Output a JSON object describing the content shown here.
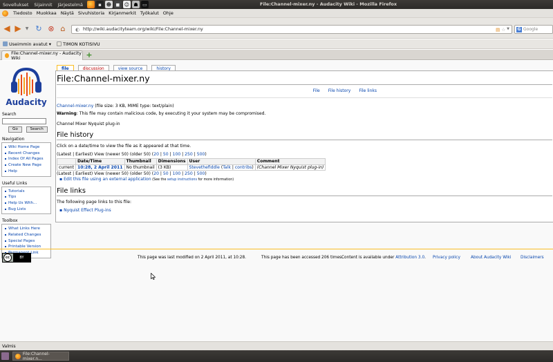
{
  "top_panel": {
    "menus": [
      "Sovellukset",
      "Sijainnit",
      "Järjestelmä"
    ],
    "window_title": "File:Channel-mixer.ny - Audacity Wiki - Mozilla Firefox"
  },
  "menubar": [
    "Tiedosto",
    "Muokkaa",
    "Näytä",
    "Sivuhistoria",
    "Kirjanmerkit",
    "Työkalut",
    "Ohje"
  ],
  "url": "http://wiki.audacityteam.org/wiki/File:Channel-mixer.ny",
  "search_engine": "Google",
  "bookmarks": [
    "Useimmin avatut ▾",
    "TIMON KOTISIVU"
  ],
  "tab_title": "File:Channel-mixer.ny - Audacity Wiki",
  "logo_text": "Audacity",
  "sidebar": {
    "search_label": "Search",
    "go_label": "Go",
    "search_button": "Search",
    "navigation_title": "Navigation",
    "navigation": [
      "Wiki Home Page",
      "Recent Changes",
      "Index Of All Pages",
      "Create New Page",
      "Help"
    ],
    "useful_links_title": "Useful Links",
    "useful_links": [
      "Tutorials",
      "Tips",
      "Help Us With...",
      "Bug Lists"
    ],
    "toolbox_title": "Toolbox",
    "toolbox": [
      "What Links Here",
      "Related Changes",
      "Special Pages",
      "Printable Version",
      "Permanent Link"
    ]
  },
  "content_tabs": [
    "file",
    "discussion",
    "view source",
    "history"
  ],
  "page": {
    "title": "File:Channel-mixer.ny",
    "toc": [
      "File",
      "File history",
      "File links"
    ],
    "file_link": "Channel-mixer.ny",
    "file_info": " (file size: 3 KB, MIME type: text/plain)",
    "warning_label": "Warning",
    "warning_text": ": This file may contain malicious code, by executing it your system may be compromised.",
    "description": "Channel Mixer Nyquist plug-in",
    "history_heading": "File history",
    "history_intro": "Click on a date/time to view the file as it appeared at that time.",
    "paging_prefix": "(Latest | Earliest) View (newer 50) (older 50) (",
    "paging_options": [
      "20",
      "50",
      "100",
      "250",
      "500"
    ],
    "paging_suffix": ")",
    "table_headers": [
      "",
      "Date/Time",
      "Thumbnail",
      "Dimensions",
      "User",
      "Comment"
    ],
    "row": {
      "status": "current",
      "datetime": "10:28, 2 April 2011",
      "thumbnail": "No thumbnail",
      "dimensions": "(3 KB)",
      "user": "Stevethefiddle",
      "user_talk": "Talk",
      "user_contribs": "contribs",
      "comment": "(Channel Mixer Nyquist plug-in)"
    },
    "edit_external": "Edit this file using an external application",
    "edit_external_note_prefix": " (See the ",
    "edit_external_note_link": "setup instructions",
    "edit_external_note_suffix": " for more information)",
    "links_heading": "File links",
    "links_intro": "The following page links to this file:",
    "links": [
      "Nyquist Effect Plug-ins"
    ]
  },
  "footer": {
    "lastmod": "This page was last modified on 2 April 2011, at 10:28.",
    "viewcount": "This page has been accessed 206 times.",
    "copyright_prefix": "Content is available under ",
    "copyright_link": "Attribution 3.0",
    "copyright_suffix": ".",
    "privacy": "Privacy policy",
    "about": "About Audacity Wiki",
    "disclaimers": "Disclaimers"
  },
  "status": "Valmis",
  "taskbar_item": "File:Channel-mixer.n..."
}
